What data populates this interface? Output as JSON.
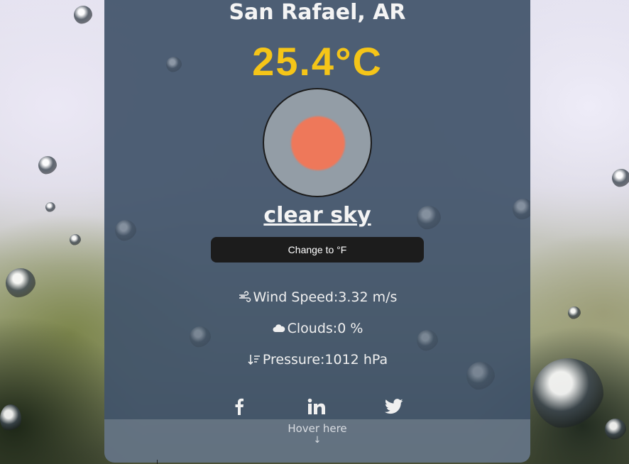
{
  "location": {
    "city": "San Rafael, AR"
  },
  "current": {
    "temperature": "25.4°C",
    "description": "clear sky",
    "icon": "clear-sky-sun-icon"
  },
  "controls": {
    "unit_toggle_label": "Change to °F"
  },
  "stats": {
    "wind_label": "Wind Speed:",
    "wind_value": "3.32 m/s",
    "clouds_label": "Clouds:",
    "clouds_value": "0 %",
    "pressure_label": "Pressure:",
    "pressure_value": "1012 hPa"
  },
  "social": {
    "links": [
      "facebook-icon",
      "linkedin-icon",
      "twitter-icon"
    ]
  },
  "footer": {
    "hover_text": "Hover here",
    "arrow": "↓"
  },
  "colors": {
    "card_bg": "#42546a",
    "temperature": "#f5c518",
    "button_bg": "#1c1c1c",
    "sun": "#ee785a",
    "icon_disc": "#939da6"
  }
}
